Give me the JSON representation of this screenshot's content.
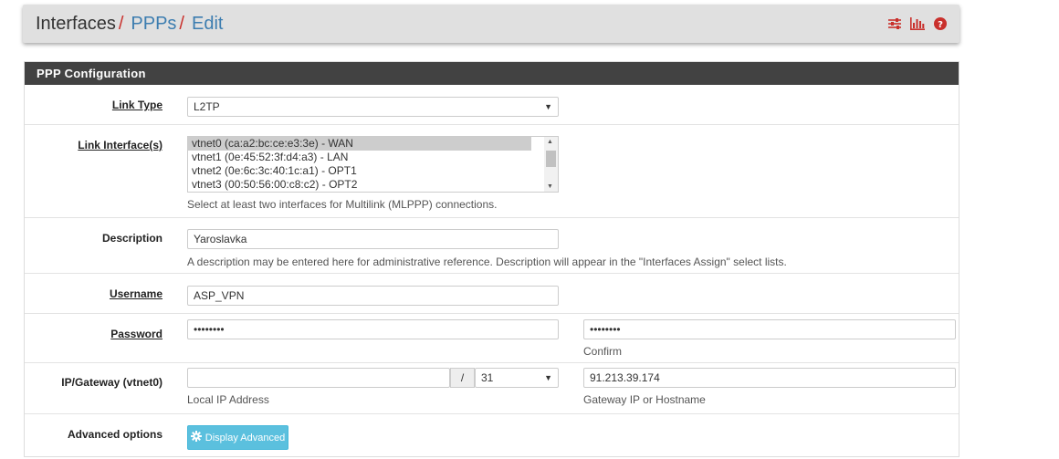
{
  "breadcrumb": {
    "root": "Interfaces",
    "items": [
      "PPPs",
      "Edit"
    ],
    "separator": "/"
  },
  "header_icons": [
    "sliders-icon",
    "bar-chart-icon",
    "help-icon"
  ],
  "panel": {
    "title": "PPP Configuration",
    "link_type": {
      "label": "Link Type",
      "value": "L2TP"
    },
    "link_interfaces": {
      "label": "Link Interface(s)",
      "options": [
        "vtnet0 (ca:a2:bc:ce:e3:3e) - WAN",
        "vtnet1 (0e:45:52:3f:d4:a3) - LAN",
        "vtnet2 (0e:6c:3c:40:1c:a1) - OPT1",
        "vtnet3 (00:50:56:00:c8:c2) - OPT2"
      ],
      "selected_index": 0,
      "help": "Select at least two interfaces for Multilink (MLPPP) connections."
    },
    "description": {
      "label": "Description",
      "value": "Yaroslavka",
      "help": "A description may be entered here for administrative reference. Description will appear in the \"Interfaces Assign\" select lists."
    },
    "username": {
      "label": "Username",
      "value": "ASP_VPN"
    },
    "password": {
      "label": "Password",
      "value": "••••••••",
      "confirm_value": "••••••••",
      "confirm_help": "Confirm"
    },
    "ip_gateway": {
      "label": "IP/Gateway (vtnet0)",
      "local_ip": "",
      "slash": "/",
      "subnet": "31",
      "local_help": "Local IP Address",
      "gateway": "91.213.39.174",
      "gateway_help": "Gateway IP or Hostname"
    },
    "advanced": {
      "label": "Advanced options",
      "button": "Display Advanced"
    }
  },
  "colors": {
    "link": "#3c7db0",
    "accent_red": "#c9302c",
    "panel_head": "#424242",
    "info_button": "#5bc0de"
  }
}
